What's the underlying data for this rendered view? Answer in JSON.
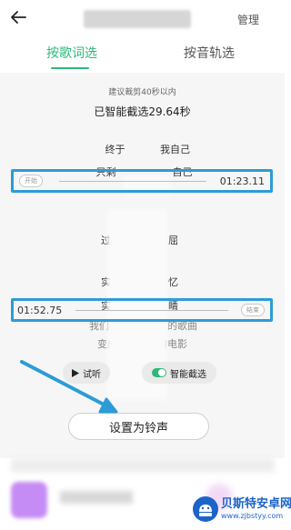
{
  "header": {
    "manage_label": "管理"
  },
  "tabs": [
    {
      "label": "按歌词选"
    },
    {
      "label": "按音轨选"
    }
  ],
  "clip": {
    "hint": "建议裁剪40秒以内",
    "selected_text": "已智能截选29.64秒",
    "start_tag": "开始",
    "start_time": "01:23.11",
    "end_tag": "结束",
    "end_time": "01:52.75"
  },
  "lyrics": [
    "终于",
    "我自己",
    "只剩",
    "自己",
    "过",
    "屈",
    "实",
    "忆",
    "实",
    "睛",
    "我们依",
    "的歌曲",
    "变成电影里懂的电影"
  ],
  "controls": {
    "audition_label": "试听",
    "smart_label": "智能截选",
    "smart_on": true
  },
  "set_ringtone_label": "设置为铃声",
  "watermark": {
    "title": "贝斯特安卓网",
    "url": "www.zjbstyy.com"
  },
  "colors": {
    "accent": "#2eb87a",
    "highlight": "#2c9cd8",
    "avatar": "#c58cf5"
  }
}
